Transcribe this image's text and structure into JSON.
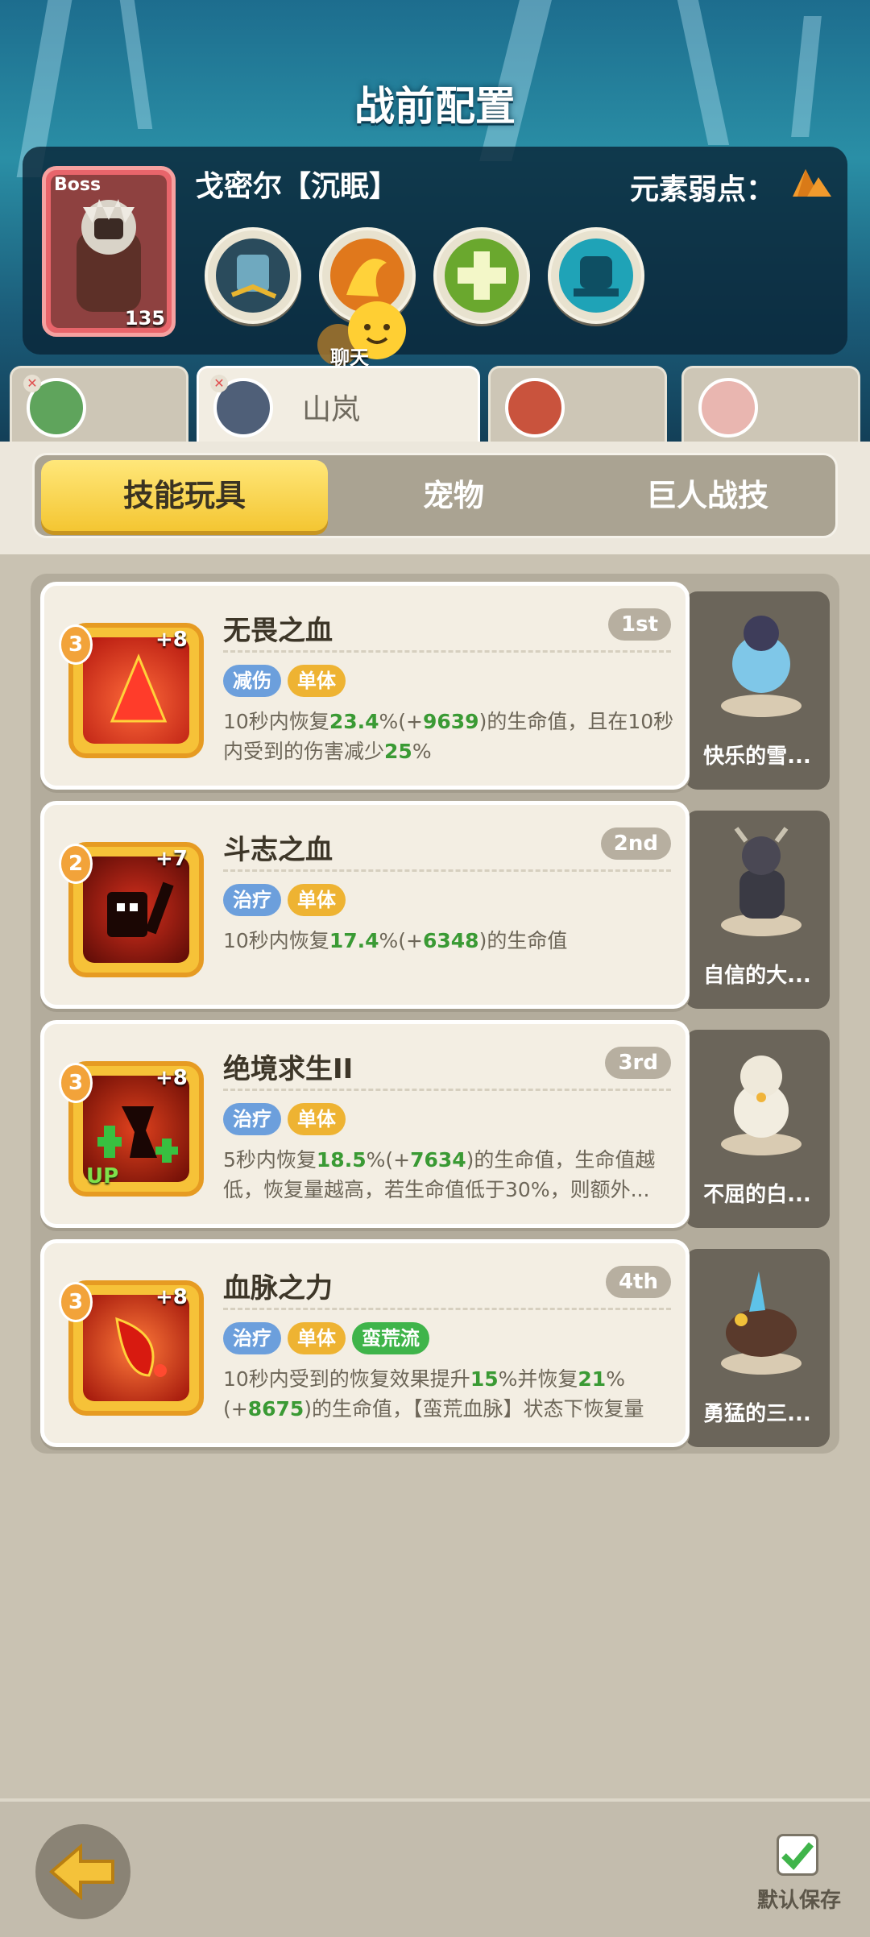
{
  "title": "战前配置",
  "boss": {
    "tag": "Boss",
    "level": "135",
    "name": "戈密尔【沉眠】",
    "weakness_label": "元素弱点："
  },
  "chat_label": "聊天",
  "characters": [
    {
      "name": "",
      "active": false
    },
    {
      "name": "山岚",
      "active": true
    },
    {
      "name": "",
      "active": false
    },
    {
      "name": "",
      "active": false
    }
  ],
  "categories": [
    "技能玩具",
    "宠物",
    "巨人战技"
  ],
  "skills": [
    {
      "name": "无畏之血",
      "rank": "1st",
      "level": "3",
      "plus": "+8",
      "tags": [
        "减伤",
        "单体"
      ],
      "desc_parts": [
        "10秒内恢复",
        "23.4",
        "%(+",
        "9639",
        ")的生命值，且在10秒内受到的伤害减少",
        "25",
        "%"
      ],
      "pet_name": "快乐的雪..."
    },
    {
      "name": "斗志之血",
      "rank": "2nd",
      "level": "2",
      "plus": "+7",
      "tags": [
        "治疗",
        "单体"
      ],
      "desc_parts": [
        "10秒内恢复",
        "17.4",
        "%(+",
        "6348",
        ")的生命值",
        "",
        ""
      ],
      "pet_name": "自信的大..."
    },
    {
      "name": "绝境求生II",
      "rank": "3rd",
      "level": "3",
      "plus": "+8",
      "up": "UP",
      "tags": [
        "治疗",
        "单体"
      ],
      "desc_parts": [
        "5秒内恢复",
        "18.5",
        "%(+",
        "7634",
        ")的生命值，生命值越低，恢复量越高，若生命值低于30%，则额外...",
        "",
        ""
      ],
      "pet_name": "不屈的白..."
    },
    {
      "name": "血脉之力",
      "rank": "4th",
      "level": "3",
      "plus": "+8",
      "tags": [
        "治疗",
        "单体",
        "蛮荒流"
      ],
      "desc_parts": [
        "10秒内受到的恢复效果提升",
        "15",
        "%并恢复",
        "21",
        "%(+",
        "8675",
        ")的生命值，【蛮荒血脉】状态下恢复量提..."
      ],
      "pet_name": "勇猛的三..."
    }
  ],
  "save_label": "默认保存",
  "colors": {
    "accent_yellow": "#f4c632",
    "heal_green": "#3a9a34",
    "tag_blue": "#6c9fdc"
  }
}
